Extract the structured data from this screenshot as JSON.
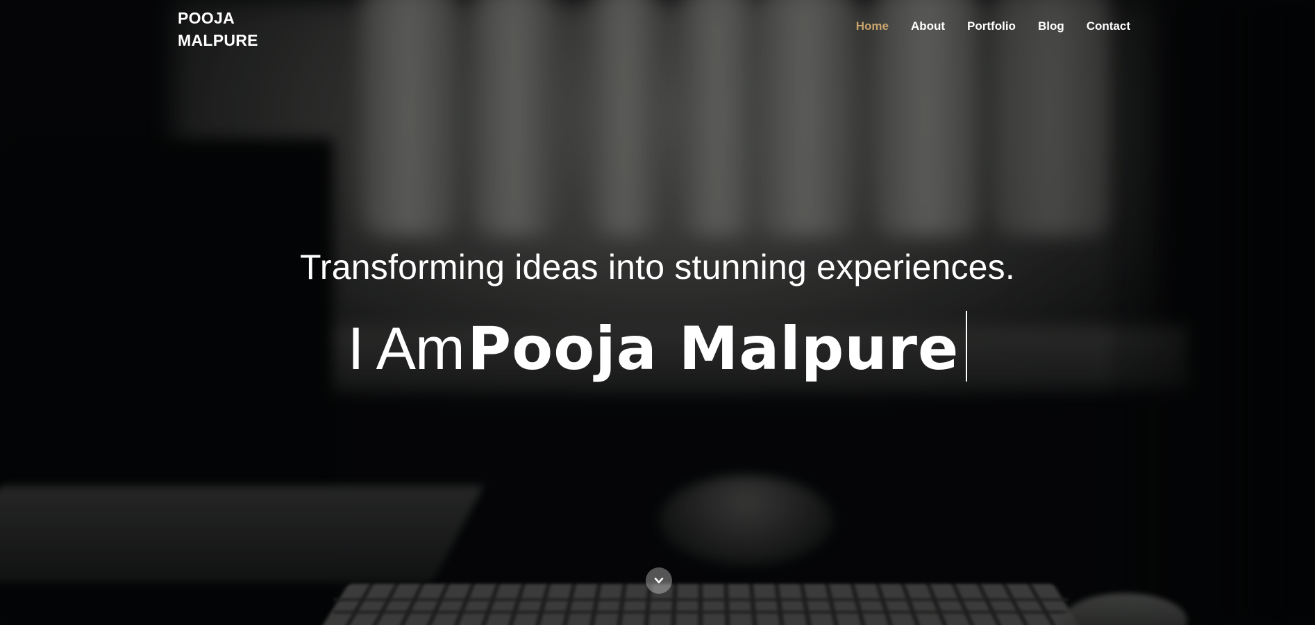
{
  "header": {
    "brand_line1": "POOJA",
    "brand_line2": "MALPURE",
    "nav": {
      "home": "Home",
      "about": "About",
      "portfolio": "Portfolio",
      "blog": "Blog",
      "contact": "Contact"
    },
    "active_item": "Home"
  },
  "hero": {
    "tagline": "Transforming ideas into stunning experiences.",
    "prefix": "I Am",
    "name": "Pooja Malpure",
    "scroll_icon": "chevron-down-icon"
  },
  "colors": {
    "accent": "#c9a46d",
    "text": "#ffffff"
  }
}
